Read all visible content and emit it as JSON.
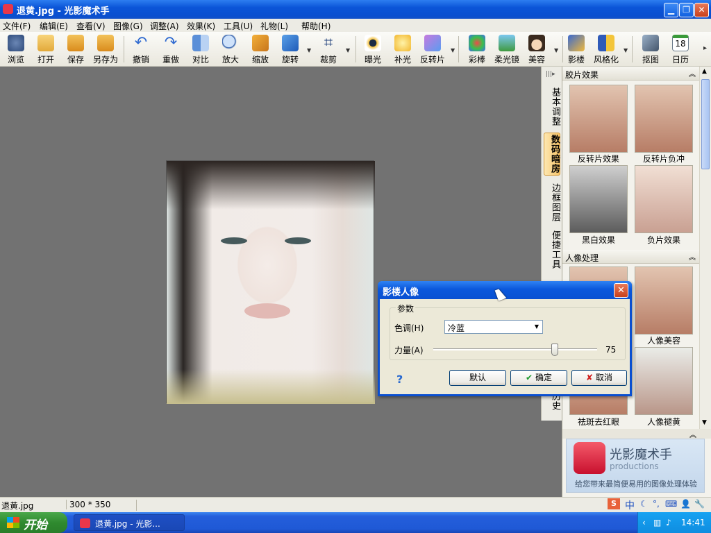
{
  "window": {
    "title": "退黄.jpg - 光影魔术手"
  },
  "menu": [
    "文件(F)",
    "编辑(E)",
    "查看(V)",
    "图像(G)",
    "调整(A)",
    "效果(K)",
    "工具(U)",
    "礼物(L)",
    "帮助(H)"
  ],
  "toolbar": [
    "浏览",
    "打开",
    "保存",
    "另存为",
    "撤销",
    "重做",
    "对比",
    "放大",
    "缩放",
    "旋转",
    "裁剪",
    "曝光",
    "补光",
    "反转片",
    "彩棒",
    "柔光镜",
    "美容",
    "影楼",
    "风格化",
    "抠图",
    "日历"
  ],
  "calendar_day": "18",
  "side_tabs": [
    "基本调整",
    "数码暗房",
    "边框图层",
    "便捷工具"
  ],
  "side_tab_partial": "历史",
  "panel": {
    "section1": "胶片效果",
    "section2": "人像处理",
    "thumbs1": [
      "反转片效果",
      "反转片负冲",
      "黑白效果",
      "负片效果"
    ],
    "thumbs2": [
      "人像美容",
      "祛斑去红眼",
      "人像褪黄"
    ]
  },
  "promo": {
    "title": "光影魔术手",
    "subtitle": "productions",
    "tagline": "给您带来最简便易用的图像处理体验"
  },
  "dialog": {
    "title": "影楼人像",
    "group": "参数",
    "tone_label": "色调(H)",
    "tone_value": "冷蓝",
    "strength_label": "力量(A)",
    "strength_value": "75",
    "strength_level": 0.75,
    "help": "?",
    "default_btn": "默认",
    "ok_btn": "确定",
    "cancel_btn": "取消"
  },
  "status": {
    "file": "退黄.jpg",
    "size": "300 * 350"
  },
  "taskbar": {
    "start": "开始",
    "task": "退黄.jpg - 光影...",
    "clock": "14:41",
    "ime": "中"
  },
  "colors": {
    "xp_blue": "#0a4fd0",
    "start_green": "#2f8a2f",
    "canvas": "#727272"
  }
}
